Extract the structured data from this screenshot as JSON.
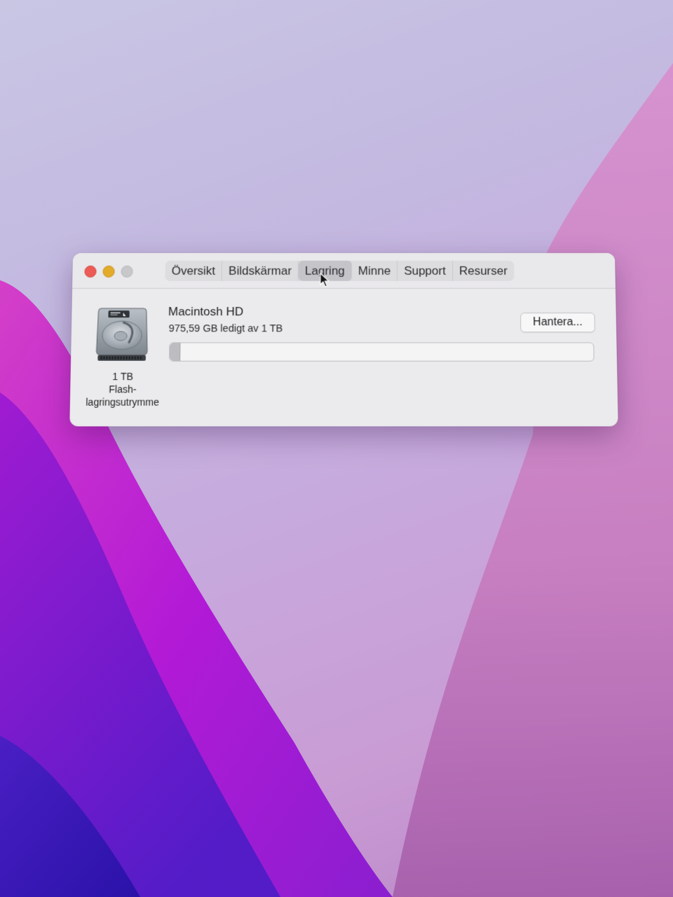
{
  "window": {
    "tabs": [
      {
        "label": "Översikt",
        "active": false
      },
      {
        "label": "Bildskärmar",
        "active": false
      },
      {
        "label": "Lagring",
        "active": true
      },
      {
        "label": "Minne",
        "active": false
      },
      {
        "label": "Support",
        "active": false
      },
      {
        "label": "Resurser",
        "active": false
      }
    ]
  },
  "storage": {
    "drive_icon": "hard-drive-icon",
    "capacity_label": "1 TB",
    "type_line1": "Flash-",
    "type_line2": "lagringsutrymme",
    "volume_name": "Macintosh HD",
    "free_text": "975,59 GB ledigt av 1 TB",
    "used_fraction": 0.024,
    "manage_label": "Hantera..."
  },
  "colors": {
    "close": "#ec5b55",
    "minimize": "#e2ab2a",
    "zoom_disabled": "#c8c7ca",
    "wallpaper_magenta": "#b01ad8",
    "wallpaper_violet": "#6a1fd0"
  }
}
